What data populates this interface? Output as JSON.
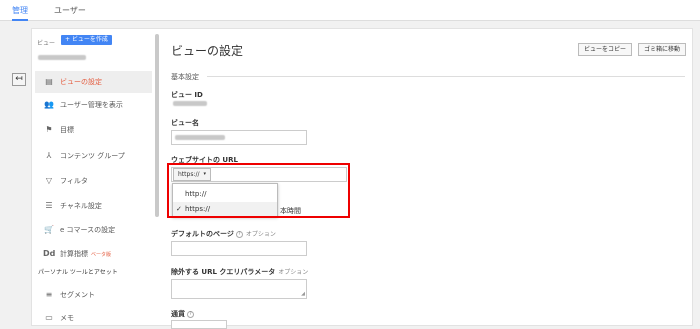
{
  "top_tabs": [
    {
      "label": "管理"
    },
    {
      "label": "ユーザー"
    }
  ],
  "sidebar": {
    "view_label": "ビュー",
    "create_view_button": "+ ビューを作成",
    "items": [
      {
        "icon": "document-icon",
        "label": "ビューの設定"
      },
      {
        "icon": "users-icon",
        "label": "ユーザー管理を表示"
      },
      {
        "icon": "flag-icon",
        "label": "目標"
      },
      {
        "icon": "content-grouping-icon",
        "label": "コンテンツ グループ"
      },
      {
        "icon": "filter-icon",
        "label": "フィルタ"
      },
      {
        "icon": "channel-settings-icon",
        "label": "チャネル設定"
      },
      {
        "icon": "ecommerce-icon",
        "label": "e コマースの設定"
      },
      {
        "icon": "calculated-metrics-icon",
        "label": "計算指標",
        "badge": "ベータ版"
      },
      {
        "icon": "segment-icon",
        "label": "セグメント"
      },
      {
        "icon": "memo-icon",
        "label": "メモ"
      }
    ],
    "personal_section": "パーソナル ツールとアセット"
  },
  "main": {
    "title": "ビューの設定",
    "copy_button": "ビューをコピー",
    "trash_button": "ゴミ箱に移動",
    "section_title": "基本設定",
    "view_id_label": "ビュー ID",
    "view_name_label": "ビュー名",
    "url_label": "ウェブサイトの URL",
    "protocol_selected": "https://",
    "protocol_options": [
      "http://",
      "https://"
    ],
    "timezone_snippet": "本時間",
    "default_page_label": "デフォルトのページ",
    "default_page_optional": "オプション",
    "exclude_params_label": "除外する URL クエリパラメータ",
    "exclude_params_optional": "オプション",
    "currency_label": "通貨"
  },
  "colors": {
    "accent": "#4285f4",
    "active": "#e45b3e",
    "highlight": "#e00000"
  }
}
